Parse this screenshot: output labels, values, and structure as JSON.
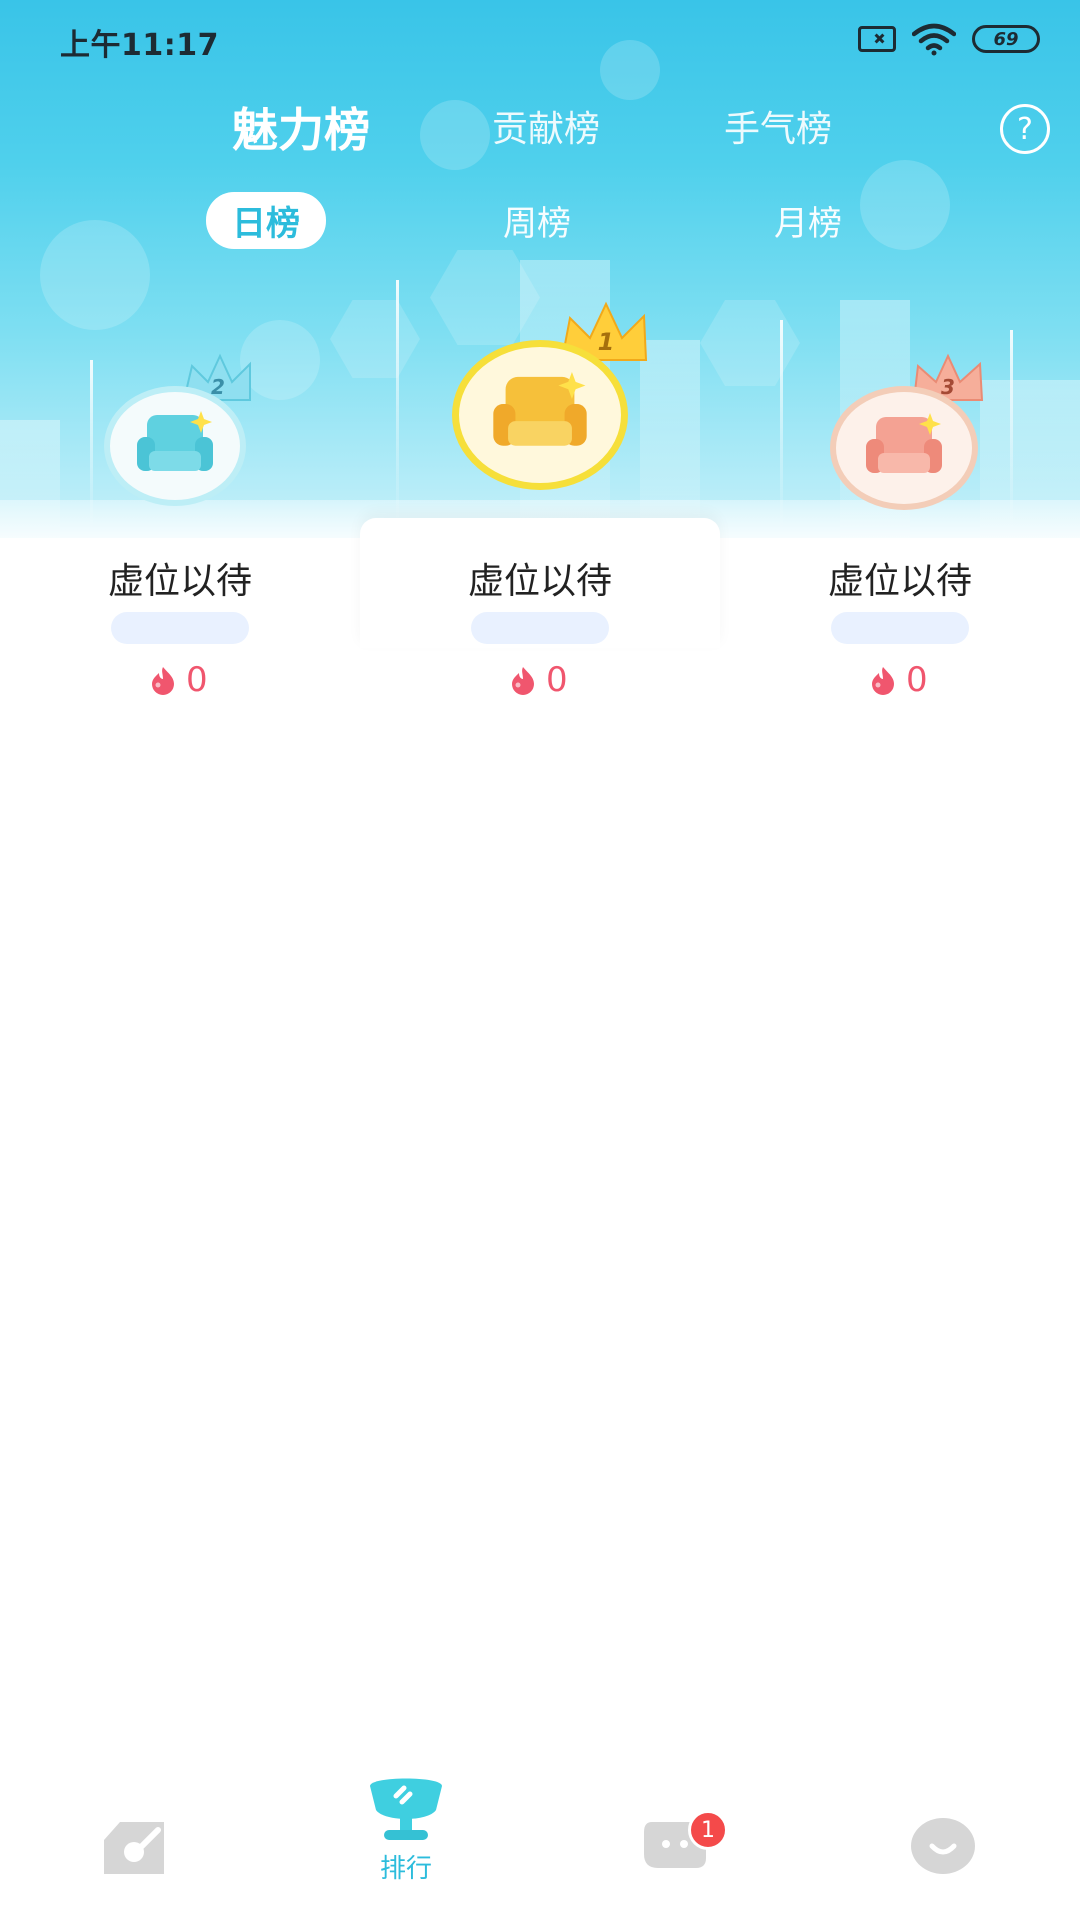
{
  "status_bar": {
    "time": "上午11:17",
    "battery": "69"
  },
  "tabs": {
    "main": [
      {
        "label": "魅力榜",
        "active": true
      },
      {
        "label": "贡献榜",
        "active": false
      },
      {
        "label": "手气榜",
        "active": false
      }
    ],
    "help": "?",
    "period": [
      {
        "label": "日榜",
        "active": true
      },
      {
        "label": "周榜",
        "active": false
      },
      {
        "label": "月榜",
        "active": false
      }
    ]
  },
  "podium": [
    {
      "rank": "2",
      "name": "虚位以待",
      "score": "0",
      "color": "#5fd1e0"
    },
    {
      "rank": "1",
      "name": "虚位以待",
      "score": "0",
      "color": "#f6c03a"
    },
    {
      "rank": "3",
      "name": "虚位以待",
      "score": "0",
      "color": "#f4a293"
    }
  ],
  "colors": {
    "accent": "#2cbcdc",
    "score": "#f0566e",
    "badge": "#f44a4a"
  },
  "bottom_nav": [
    {
      "icon": "disc-icon",
      "label": "",
      "active": false
    },
    {
      "icon": "trophy-icon",
      "label": "排行",
      "active": true
    },
    {
      "icon": "chat-icon",
      "label": "",
      "badge": "1",
      "active": false
    },
    {
      "icon": "profile-icon",
      "label": "",
      "active": false
    }
  ]
}
